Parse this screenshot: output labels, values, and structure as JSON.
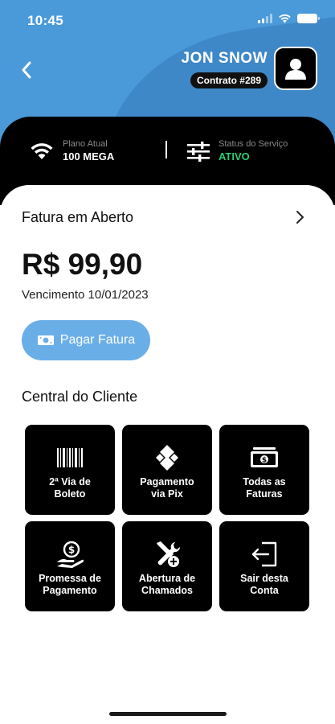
{
  "status_bar": {
    "time": "10:45"
  },
  "header": {
    "user_name": "JON SNOW",
    "contract": "Contrato #289"
  },
  "service_info": {
    "plan": {
      "label": "Plano Atual",
      "value": "100 MEGA",
      "icon": "wifi-icon"
    },
    "status": {
      "label": "Status do Serviço",
      "value": "ATIVO",
      "icon": "sliders-icon",
      "value_color": "#2ecc71"
    }
  },
  "invoice": {
    "title": "Fatura em Aberto",
    "amount": "R$ 99,90",
    "due": "Vencimento 10/01/2023",
    "pay_label": "Pagar Fatura"
  },
  "customer_center": {
    "title": "Central do Cliente",
    "tiles": [
      {
        "label": "2ª Via de\nBoleto",
        "icon": "barcode-icon"
      },
      {
        "label": "Pagamento\nvia Pix",
        "icon": "pix-icon"
      },
      {
        "label": "Todas as\nFaturas",
        "icon": "cash-icon"
      },
      {
        "label": "Promessa de\nPagamento",
        "icon": "coin-hand-icon"
      },
      {
        "label": "Abertura de\nChamados",
        "icon": "tools-icon"
      },
      {
        "label": "Sair desta\nConta",
        "icon": "logout-icon"
      }
    ]
  },
  "colors": {
    "header_blue": "#4a9ad9",
    "button_blue": "#6aaee8",
    "active_green": "#2ecc71"
  }
}
